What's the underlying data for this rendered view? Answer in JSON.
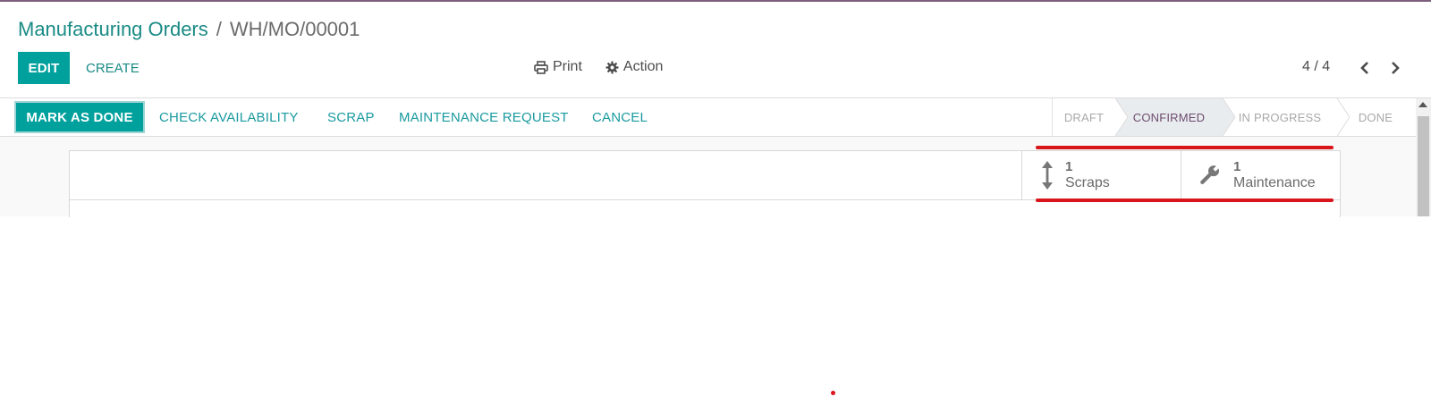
{
  "breadcrumb": {
    "parent": "Manufacturing Orders",
    "separator": "/",
    "current": "WH/MO/00001"
  },
  "toolbar": {
    "edit_label": "EDIT",
    "create_label": "CREATE",
    "print_label": "Print",
    "action_label": "Action"
  },
  "pager": {
    "value": "4 / 4"
  },
  "statusbar": {
    "buttons": {
      "mark_done": "MARK AS DONE",
      "check_availability": "CHECK AVAILABILITY",
      "scrap": "SCRAP",
      "maintenance_request": "MAINTENANCE REQUEST",
      "cancel": "CANCEL"
    },
    "stages": [
      {
        "label": "DRAFT",
        "active": false
      },
      {
        "label": "CONFIRMED",
        "active": true
      },
      {
        "label": "IN PROGRESS",
        "active": false
      },
      {
        "label": "DONE",
        "active": false
      }
    ]
  },
  "smart_buttons": [
    {
      "count": "1",
      "label": "Scraps",
      "icon": "arrows-v-icon"
    },
    {
      "count": "1",
      "label": "Maintenance",
      "icon": "wrench-icon"
    }
  ],
  "colors": {
    "brand": "#7c5f7d",
    "primary": "#00a09d",
    "link": "#1a8b85",
    "annotation": "#d8151b"
  }
}
